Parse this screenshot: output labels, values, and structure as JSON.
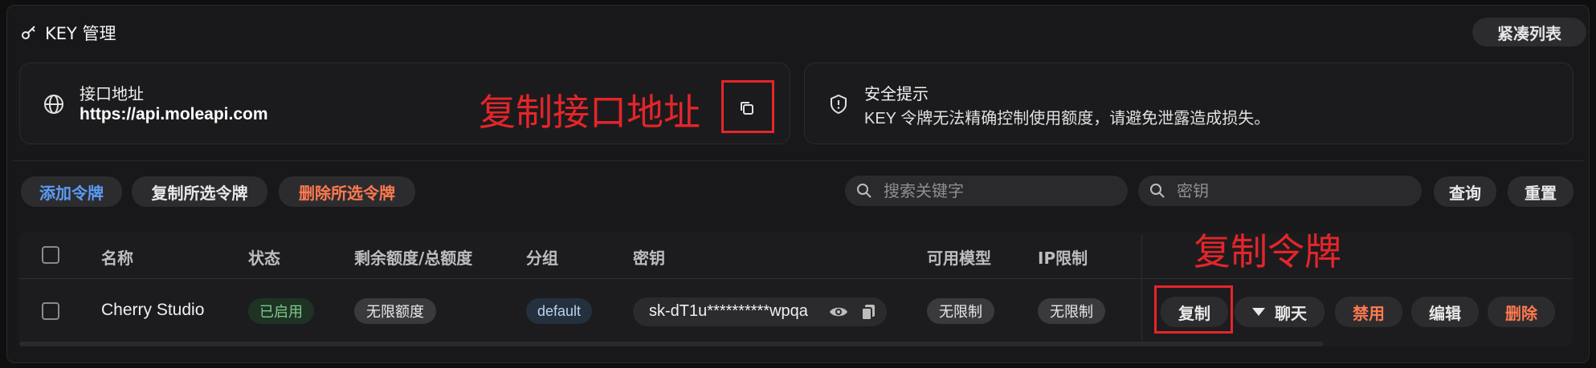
{
  "header": {
    "title": "KEY 管理",
    "compact_label": "紧凑列表"
  },
  "api_card": {
    "title": "接口地址",
    "url": "https://api.moleapi.com"
  },
  "security_card": {
    "title": "安全提示",
    "message": "KEY 令牌无法精确控制使用额度，请避免泄露造成损失。"
  },
  "annotations": {
    "copy_api": "复制接口地址",
    "copy_token": "复制令牌",
    "color": "#e5252a"
  },
  "toolbar": {
    "add_token": "添加令牌",
    "copy_selected": "复制所选令牌",
    "delete_selected": "删除所选令牌",
    "search_placeholder": "搜索关键字",
    "key_placeholder": "密钥",
    "query": "查询",
    "reset": "重置"
  },
  "table": {
    "columns": [
      "名称",
      "状态",
      "剩余额度/总额度",
      "分组",
      "密钥",
      "可用模型",
      "IP限制"
    ],
    "rows": [
      {
        "name": "Cherry Studio",
        "status": "已启用",
        "quota": "无限额度",
        "group": "default",
        "key": "sk-dT1u**********wpqa",
        "models": "无限制",
        "ip": "无限制",
        "actions": {
          "copy": "复制",
          "chat": "聊天",
          "disable": "禁用",
          "edit": "编辑",
          "delete": "删除"
        }
      }
    ]
  },
  "colors": {
    "accent_blue": "#5b9cf5",
    "danger_orange": "#ff7a4f",
    "status_green": "#7fc98a"
  }
}
